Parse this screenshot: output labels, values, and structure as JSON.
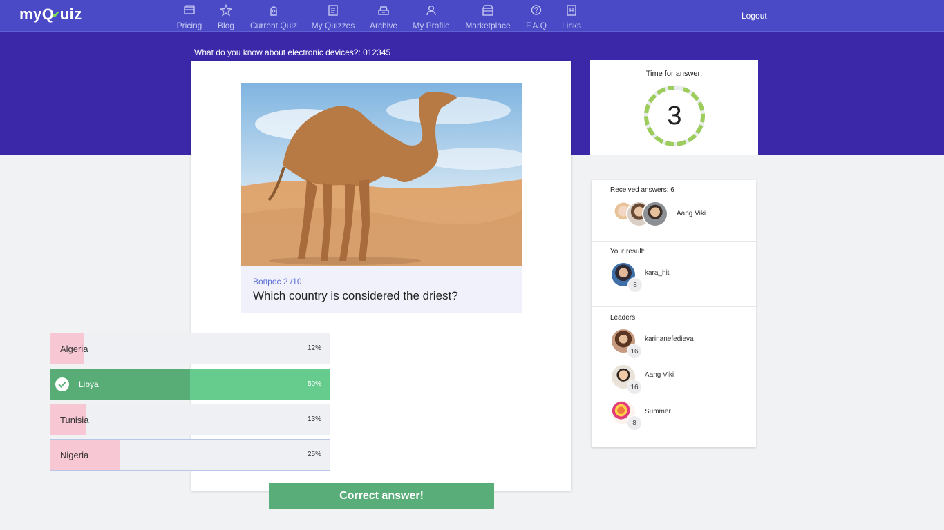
{
  "nav": {
    "logo": "myQuiz",
    "items": [
      {
        "label": "Pricing",
        "icon": "pricing-icon"
      },
      {
        "label": "Blog",
        "icon": "star-icon"
      },
      {
        "label": "Current Quiz",
        "icon": "current-quiz-icon"
      },
      {
        "label": "My Quizzes",
        "icon": "quizzes-icon"
      },
      {
        "label": "Archive",
        "icon": "archive-icon"
      },
      {
        "label": "My Profile",
        "icon": "profile-icon"
      },
      {
        "label": "Marketplace",
        "icon": "marketplace-icon"
      },
      {
        "label": "F.A.Q",
        "icon": "faq-icon"
      },
      {
        "label": "Links",
        "icon": "links-icon"
      }
    ],
    "logout": "Logout"
  },
  "quiz": {
    "title": "What do you know about electronic devices?: 012345",
    "image_alt": "camel-in-desert",
    "question_number": "Вопрос 2 /10",
    "question": "Which country is considered the driest?",
    "answers": [
      {
        "label": "Algeria",
        "percent": "12%",
        "correct": false
      },
      {
        "label": "Libya",
        "percent": "50%",
        "correct": true
      },
      {
        "label": "Tunisia",
        "percent": "13%",
        "correct": false
      },
      {
        "label": "Nigeria",
        "percent": "25%",
        "correct": false
      }
    ],
    "result_button": "Correct answer!"
  },
  "timer": {
    "label": "Time for answer:",
    "value": "3"
  },
  "sidebar": {
    "received_title": "Received answers: 6",
    "received_name": "Aang Viki",
    "your_result_title": "Your result:",
    "your_result": {
      "name": "kara_hit",
      "score": "8"
    },
    "leaders_title": "Leaders",
    "leaders": [
      {
        "name": "karinanefedieva",
        "score": "16"
      },
      {
        "name": "Aang Viki",
        "score": "16"
      },
      {
        "name": "Summer",
        "score": "8"
      }
    ]
  },
  "colors": {
    "nav_bg": "#4a4ac6",
    "hero_bg": "#3a28a8",
    "correct_green": "#59ad79",
    "wrong_pink": "#f7c7d4",
    "timer_green": "#9ccc5c"
  }
}
